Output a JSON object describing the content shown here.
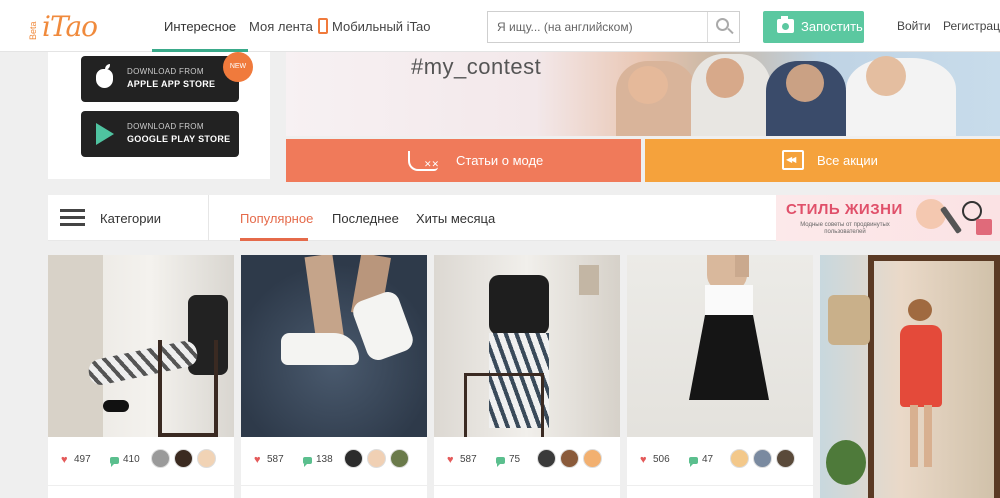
{
  "header": {
    "logo_beta": "Beta",
    "logo_name": "iTao",
    "nav": [
      {
        "label": "Интересное"
      },
      {
        "label": "Моя лента"
      },
      {
        "label": "Мобильный iTao"
      }
    ],
    "search_placeholder": "Я ищу... (на английском)",
    "post_button": "Запостить",
    "login": "Войти",
    "register": "Регистрация"
  },
  "app_promo": {
    "badge": "NEW",
    "apple": {
      "small": "DOWNLOAD FROM",
      "big": "APPLE APP STORE"
    },
    "google": {
      "small": "DOWNLOAD FROM",
      "big": "GOOGLE PLAY STORE"
    }
  },
  "banner": {
    "hashtag": "#my_contest"
  },
  "quick_links": {
    "articles": "Статьи о моде",
    "deals": "Все акции"
  },
  "catbar": {
    "categories": "Категории",
    "tabs": [
      {
        "label": "Популярное"
      },
      {
        "label": "Последнее"
      },
      {
        "label": "Хиты месяца"
      }
    ],
    "style_banner": {
      "title": "СТИЛЬ ЖИЗНИ",
      "subtitle": "Модные советы от продвинутых пользователей"
    }
  },
  "cards": [
    {
      "likes": "497",
      "comments": "410"
    },
    {
      "likes": "587",
      "comments": "138"
    },
    {
      "likes": "587",
      "comments": "75"
    },
    {
      "likes": "506",
      "comments": "47"
    }
  ],
  "colors": {
    "brand": "#f08a3c",
    "green": "#5bc8a0",
    "coral": "#f07a5a",
    "orange": "#f5a23c",
    "active_tab": "#e56a4a"
  }
}
